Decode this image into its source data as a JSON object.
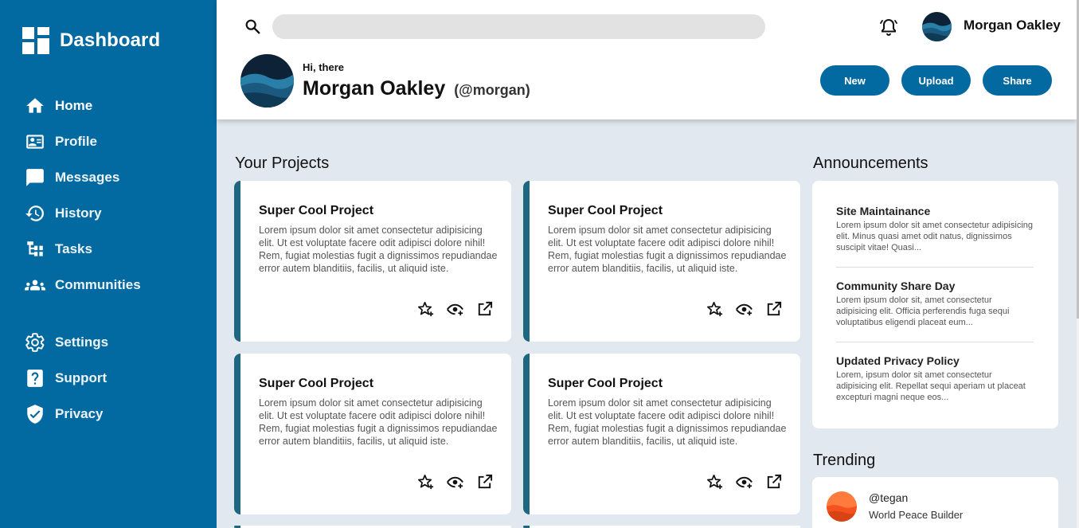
{
  "brand": {
    "title": "Dashboard",
    "icon": "dashboard-grid-icon"
  },
  "sidebar": {
    "items": [
      {
        "label": "Home",
        "icon": "home-icon"
      },
      {
        "label": "Profile",
        "icon": "id-card-icon"
      },
      {
        "label": "Messages",
        "icon": "message-icon"
      },
      {
        "label": "History",
        "icon": "history-icon"
      },
      {
        "label": "Tasks",
        "icon": "tasks-icon"
      },
      {
        "label": "Communities",
        "icon": "communities-icon"
      },
      {
        "label": "Settings",
        "icon": "gear-icon"
      },
      {
        "label": "Support",
        "icon": "help-icon"
      },
      {
        "label": "Privacy",
        "icon": "shield-icon"
      }
    ]
  },
  "header": {
    "search_placeholder": "",
    "user_name": "Morgan Oakley",
    "greeting": "Hi, there",
    "display_name": "Morgan Oakley",
    "handle": "(@morgan)",
    "buttons": {
      "new": "New",
      "upload": "Upload",
      "share": "Share"
    }
  },
  "projects": {
    "title": "Your Projects",
    "cards": [
      {
        "title": "Super Cool Project",
        "body": "Lorem ipsum dolor sit amet consectetur adipisicing elit. Ut est voluptate facere odit adipisci dolore nihil! Rem, fugiat molestias fugit a dignissimos repudiandae error autem blanditiis, facilis, ut aliquid iste."
      },
      {
        "title": "Super Cool Project",
        "body": "Lorem ipsum dolor sit amet consectetur adipisicing elit. Ut est voluptate facere odit adipisci dolore nihil! Rem, fugiat molestias fugit a dignissimos repudiandae error autem blanditiis, facilis, ut aliquid iste."
      },
      {
        "title": "Super Cool Project",
        "body": "Lorem ipsum dolor sit amet consectetur adipisicing elit. Ut est voluptate facere odit adipisci dolore nihil! Rem, fugiat molestias fugit a dignissimos repudiandae error autem blanditiis, facilis, ut aliquid iste."
      },
      {
        "title": "Super Cool Project",
        "body": "Lorem ipsum dolor sit amet consectetur adipisicing elit. Ut est voluptate facere odit adipisci dolore nihil! Rem, fugiat molestias fugit a dignissimos repudiandae error autem blanditiis, facilis, ut aliquid iste."
      }
    ]
  },
  "announcements": {
    "title": "Announcements",
    "items": [
      {
        "title": "Site Maintainance",
        "text": "Lorem ipsum dolor sit amet consectetur adipisicing elit. Minus quasi amet odit natus, dignissimos suscipit vitae! Quasi..."
      },
      {
        "title": "Community Share Day",
        "text": "Lorem ipsum dolor sit, amet consectetur adipisicing elit. Officia perferendis fuga sequi voluptatibus eligendi placeat eum..."
      },
      {
        "title": "Updated Privacy Policy",
        "text": "Lorem, ipsum dolor sit amet consectetur adipisicing elit. Repellat sequi aperiam ut placeat excepturi magni neque eos..."
      }
    ]
  },
  "trending": {
    "title": "Trending",
    "items": [
      {
        "handle": "@tegan",
        "subtitle": "World Peace Builder"
      }
    ]
  },
  "colors": {
    "sidebar": "#0369a1",
    "accent": "#0369a1",
    "card_border": "#1f6680",
    "background": "#e2e8f0"
  }
}
